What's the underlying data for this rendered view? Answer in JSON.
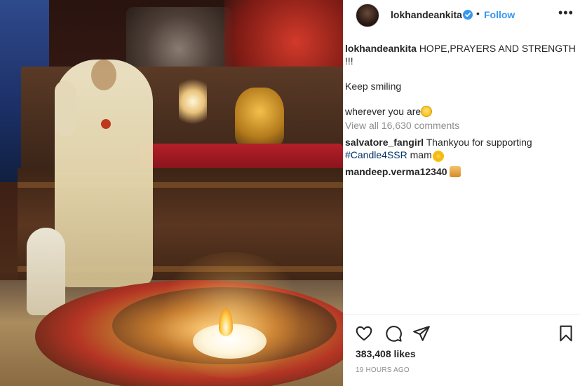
{
  "post": {
    "image_alt": "lokhandeankita post photo",
    "author": {
      "username": "lokhandeankita",
      "verified": true,
      "follow_label": "Follow",
      "separator": "•"
    },
    "more_label": "•••",
    "caption": {
      "username": "lokhandeankita",
      "line1": "HOPE,PRAYERS AND STRENGTH !!!",
      "line2": "Keep smiling",
      "line3": "wherever you are",
      "line3_emoji": "smiling-face-emoji"
    },
    "view_all_comments": "View all 16,630 comments",
    "comments": [
      {
        "username": "salvatore_fangirl",
        "text": "Thankyou for supporting",
        "hashtag": "#Candle4SSR",
        "text_after": "mam",
        "emoji": "sun-emoji"
      },
      {
        "username": "mandeep.verma12340",
        "text": "",
        "emoji": "praying-hands-emoji"
      }
    ],
    "likes": "383,408 likes",
    "timestamp": "19 HOURS AGO",
    "actions": [
      "like-icon",
      "comment-icon",
      "share-icon",
      "save-icon"
    ]
  },
  "colors": {
    "link": "#3897f0",
    "text": "#262626",
    "muted": "#8e8e8e",
    "hashtag": "#003569",
    "verified": "#3897f0"
  }
}
